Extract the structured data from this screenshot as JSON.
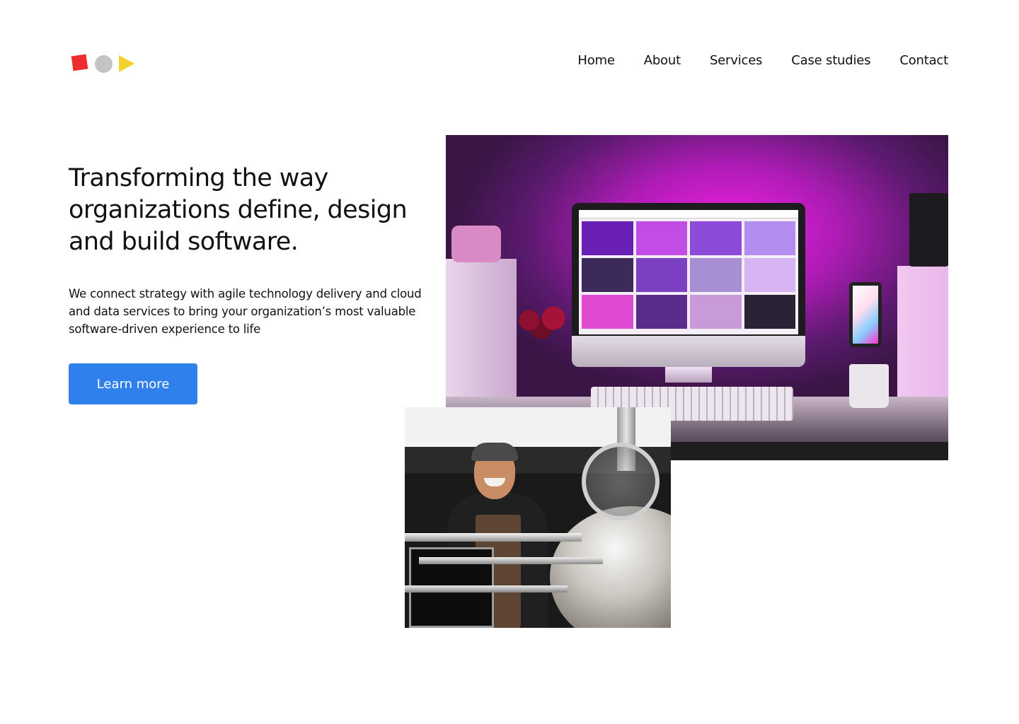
{
  "logo": {
    "colors": {
      "square": "#ee2e2e",
      "circle": "#c4c4c4",
      "triangle": "#f2d22e"
    }
  },
  "nav": {
    "items": [
      {
        "label": "Home"
      },
      {
        "label": "About"
      },
      {
        "label": "Services"
      },
      {
        "label": "Case studies"
      },
      {
        "label": "Contact"
      }
    ]
  },
  "hero": {
    "headline": "Transforming the way organizations define, design and build software.",
    "subtext": "We connect strategy with agile technology delivery and cloud and data services to bring your organization’s most valuable software-driven experience to life",
    "cta_label": "Learn more",
    "cta_color": "#2f7fec"
  },
  "images": {
    "desk": {
      "description": "desk setup with monitor and pink lighting"
    },
    "brewer": {
      "description": "smiling man at brewing equipment"
    }
  }
}
